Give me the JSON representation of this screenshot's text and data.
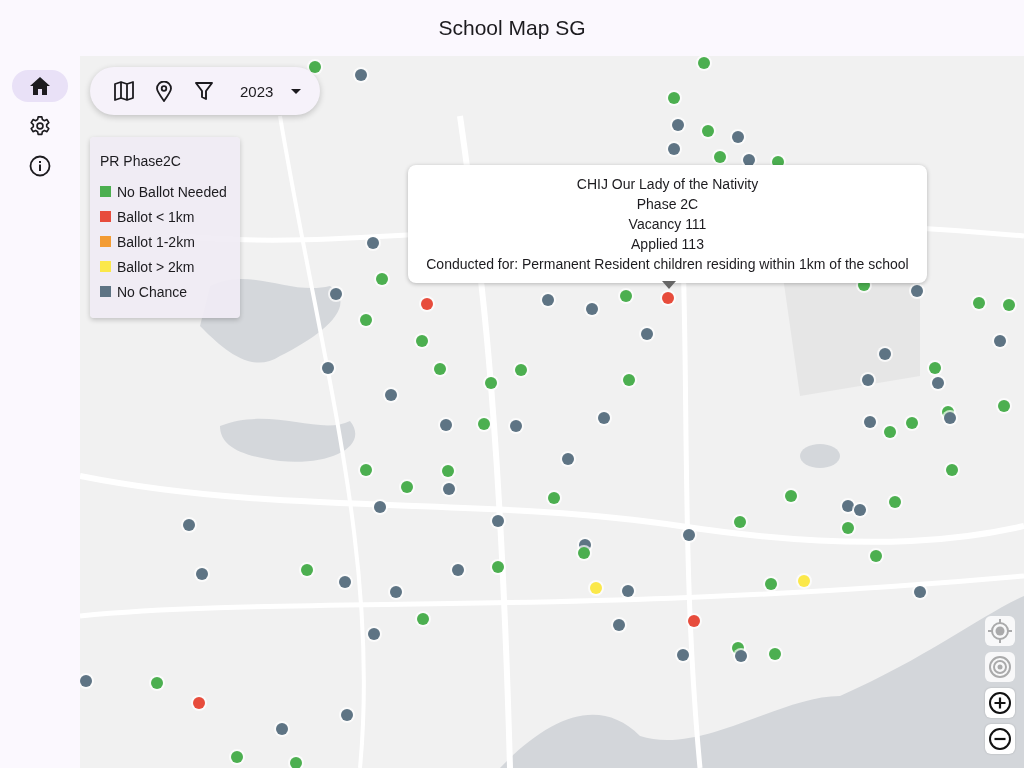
{
  "app": {
    "title": "School Map SG"
  },
  "nav": [
    {
      "kind": "home",
      "selected": true
    },
    {
      "kind": "settings",
      "selected": false
    },
    {
      "kind": "info",
      "selected": false
    }
  ],
  "toolbar": {
    "year": "2023"
  },
  "legend": {
    "title": "PR Phase2C",
    "items": [
      {
        "label": "No Ballot Needed",
        "color": "#4caf50"
      },
      {
        "label": "Ballot < 1km",
        "color": "#e74c3c"
      },
      {
        "label": "Ballot 1-2km",
        "color": "#f39c34"
      },
      {
        "label": "Ballot > 2km",
        "color": "#fbe84a"
      },
      {
        "label": "No Chance",
        "color": "#5e7484"
      }
    ]
  },
  "popup": {
    "lines": [
      "CHIJ Our Lady of the Nativity",
      "Phase 2C",
      "Vacancy 111",
      "Applied 113",
      "Conducted for: Permanent Resident children residing within 1km of the school"
    ]
  },
  "markers": [
    {
      "color": "#4caf50"
    },
    {
      "color": "#5e7484"
    },
    {
      "color": "#4caf50"
    },
    {
      "color": "#4caf50"
    },
    {
      "color": "#5e7484"
    },
    {
      "color": "#4caf50"
    },
    {
      "color": "#5e7484"
    },
    {
      "color": "#5e7484"
    },
    {
      "color": "#4caf50"
    },
    {
      "color": "#5e7484"
    },
    {
      "color": "#4caf50"
    },
    {
      "color": "#5e7484"
    },
    {
      "color": "#4caf50"
    },
    {
      "color": "#5e7484"
    },
    {
      "color": "#e74c3c"
    },
    {
      "color": "#4caf50"
    },
    {
      "color": "#4caf50"
    },
    {
      "color": "#5e7484"
    },
    {
      "color": "#5e7484"
    },
    {
      "color": "#4caf50"
    },
    {
      "color": "#e74c3c"
    },
    {
      "color": "#5e7484"
    },
    {
      "color": "#4caf50"
    },
    {
      "color": "#5e7484"
    },
    {
      "color": "#4caf50"
    },
    {
      "color": "#4caf50"
    },
    {
      "color": "#5e7484"
    },
    {
      "color": "#5e7484"
    },
    {
      "color": "#4caf50"
    },
    {
      "color": "#5e7484"
    },
    {
      "color": "#5e7484"
    },
    {
      "color": "#4caf50"
    },
    {
      "color": "#4caf50"
    },
    {
      "color": "#5e7484"
    },
    {
      "color": "#5e7484"
    },
    {
      "color": "#4caf50"
    },
    {
      "color": "#4caf50"
    },
    {
      "color": "#4caf50"
    },
    {
      "color": "#5e7484"
    },
    {
      "color": "#5e7484"
    },
    {
      "color": "#4caf50"
    },
    {
      "color": "#4caf50"
    },
    {
      "color": "#4caf50"
    },
    {
      "color": "#4caf50"
    },
    {
      "color": "#5e7484"
    },
    {
      "color": "#5e7484"
    },
    {
      "color": "#4caf50"
    },
    {
      "color": "#5e7484"
    },
    {
      "color": "#5e7484"
    },
    {
      "color": "#4caf50"
    },
    {
      "color": "#4caf50"
    },
    {
      "color": "#4caf50"
    },
    {
      "color": "#5e7484"
    },
    {
      "color": "#5e7484"
    },
    {
      "color": "#4caf50"
    },
    {
      "color": "#5e7484"
    },
    {
      "color": "#4caf50"
    },
    {
      "color": "#5e7484"
    },
    {
      "color": "#5e7484"
    },
    {
      "color": "#4caf50"
    },
    {
      "color": "#4caf50"
    },
    {
      "color": "#4caf50"
    },
    {
      "color": "#4caf50"
    },
    {
      "color": "#5e7484"
    },
    {
      "color": "#5e7484"
    },
    {
      "color": "#4caf50"
    },
    {
      "color": "#5e7484"
    },
    {
      "color": "#5e7484"
    },
    {
      "color": "#4caf50"
    },
    {
      "color": "#5e7484"
    },
    {
      "color": "#5e7484"
    },
    {
      "color": "#5e7484"
    },
    {
      "color": "#4caf50"
    },
    {
      "color": "#fbe84a"
    },
    {
      "color": "#5e7484"
    },
    {
      "color": "#4caf50"
    },
    {
      "color": "#fbe84a"
    },
    {
      "color": "#5e7484"
    },
    {
      "color": "#4caf50"
    },
    {
      "color": "#5e7484"
    },
    {
      "color": "#5e7484"
    },
    {
      "color": "#e74c3c"
    },
    {
      "color": "#4caf50"
    },
    {
      "color": "#5e7484"
    },
    {
      "color": "#4caf50"
    },
    {
      "color": "#5e7484"
    },
    {
      "color": "#5e7484"
    },
    {
      "color": "#4caf50"
    },
    {
      "color": "#e74c3c"
    },
    {
      "color": "#5e7484"
    },
    {
      "color": "#5e7484"
    },
    {
      "color": "#4caf50"
    },
    {
      "color": "#4caf50"
    }
  ],
  "map_controls": [
    {
      "kind": "locate",
      "disabled": true
    },
    {
      "kind": "compass",
      "disabled": true
    },
    {
      "kind": "zoom_in",
      "disabled": false
    },
    {
      "kind": "zoom_out",
      "disabled": false
    }
  ]
}
